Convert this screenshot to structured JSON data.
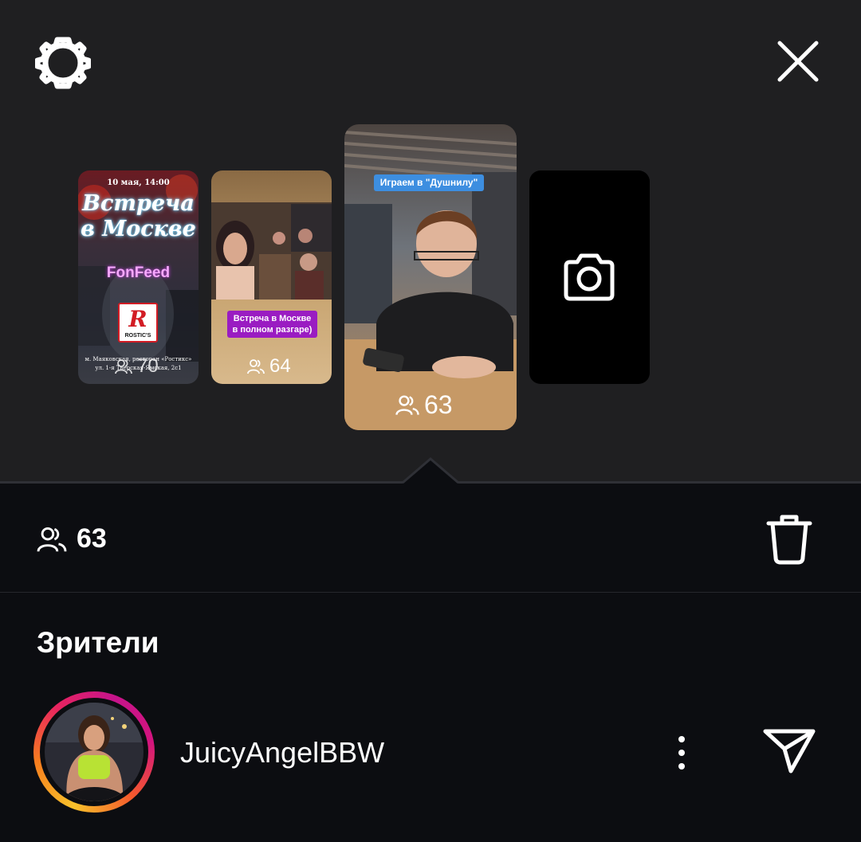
{
  "header": {
    "settings_icon": "gear-icon",
    "close_icon": "close-icon"
  },
  "stories": [
    {
      "date": "10 мая, 14:00",
      "title_line1": "Встреча",
      "title_line2": "в Москве",
      "brand": "FonFeed",
      "logo_letter": "R",
      "logo_text": "ROSTIC'S",
      "address_line1": "м. Маяковская, ресторан «Ростикс»",
      "address_line2": "ул. 1-я Тверская-Ямская, 2с1",
      "views": "70"
    },
    {
      "sticker": "Встреча в Москве в полном разгаре)",
      "views": "64"
    },
    {
      "sticker": "Играем в \"Душнилу\"",
      "views": "63"
    },
    {
      "add_icon": "camera-icon"
    }
  ],
  "stats": {
    "viewers_count": "63",
    "viewers_icon": "people-icon",
    "delete_icon": "trash-icon"
  },
  "viewers_section": {
    "title": "Зрители",
    "items": [
      {
        "username": "JuicyAngelBBW",
        "more_icon": "more-vertical-icon",
        "send_icon": "send-icon"
      }
    ]
  },
  "colors": {
    "top_background": "#1f1f21",
    "bottom_background": "#0c0d11",
    "story_ring_start": "#f8c12b",
    "story_ring_end": "#c6148b"
  }
}
